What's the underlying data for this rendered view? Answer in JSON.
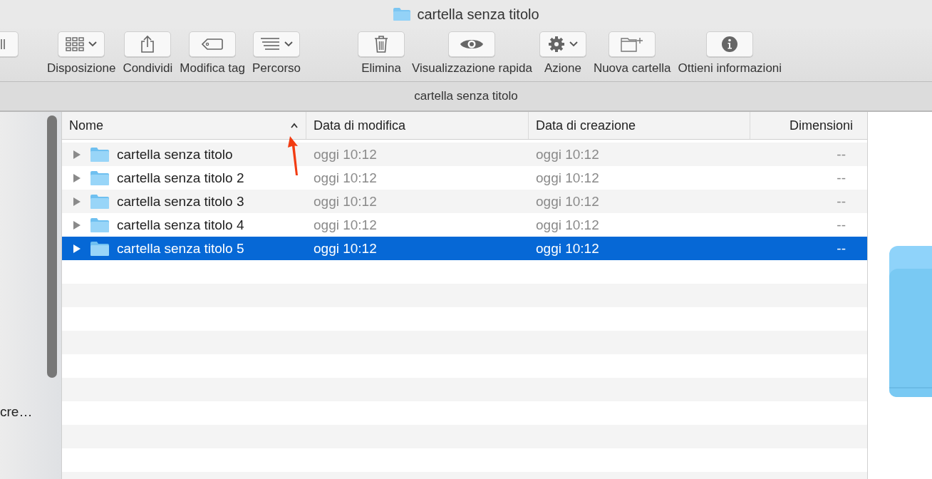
{
  "window": {
    "title": "cartella senza titolo"
  },
  "toolbar": [
    {
      "kind": "panel",
      "menu": false
    },
    {
      "kind": "arrange",
      "label": "Disposizione",
      "menu": true
    },
    {
      "kind": "share",
      "label": "Condividi",
      "menu": false
    },
    {
      "kind": "tag",
      "label": "Modifica tag",
      "menu": false
    },
    {
      "kind": "path",
      "label": "Percorso",
      "menu": true
    },
    {
      "kind": "trash",
      "label": "Elimina",
      "menu": false
    },
    {
      "kind": "eye",
      "label": "Visualizzazione rapida",
      "menu": false
    },
    {
      "kind": "gear",
      "label": "Azione",
      "menu": true
    },
    {
      "kind": "newfolder",
      "label": "Nuova cartella",
      "menu": false
    },
    {
      "kind": "info",
      "label": "Ottieni informazioni",
      "menu": false
    }
  ],
  "path_bar": {
    "title": "cartella senza titolo"
  },
  "sidebar": {
    "items": [
      {
        "label": "cre…"
      }
    ]
  },
  "table": {
    "columns": [
      {
        "label": "Nome",
        "sorted": true
      },
      {
        "label": "Data di modifica",
        "sorted": false
      },
      {
        "label": "Data di creazione",
        "sorted": false
      },
      {
        "label": "Dimensioni",
        "sorted": false
      }
    ],
    "rows": [
      {
        "name": "cartella senza titolo",
        "modified": "oggi 10:12",
        "created": "oggi 10:12",
        "size": "--",
        "expanded": false,
        "selected": false
      },
      {
        "name": "cartella senza titolo 2",
        "modified": "oggi 10:12",
        "created": "oggi 10:12",
        "size": "--",
        "expanded": false,
        "selected": false
      },
      {
        "name": "cartella senza titolo 3",
        "modified": "oggi 10:12",
        "created": "oggi 10:12",
        "size": "--",
        "expanded": false,
        "selected": false
      },
      {
        "name": "cartella senza titolo 4",
        "modified": "oggi 10:12",
        "created": "oggi 10:12",
        "size": "--",
        "expanded": false,
        "selected": false
      },
      {
        "name": "cartella senza titolo 5",
        "modified": "oggi 10:12",
        "created": "oggi 10:12",
        "size": "--",
        "expanded": false,
        "selected": true
      }
    ]
  }
}
